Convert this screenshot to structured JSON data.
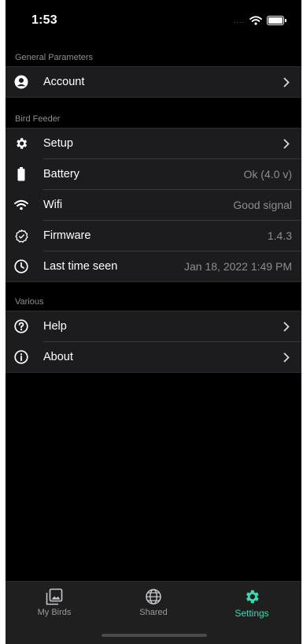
{
  "status_bar": {
    "time": "1:53",
    "signal_dots": "....",
    "wifi_icon": "wifi-icon",
    "battery_icon": "battery-icon"
  },
  "sections": {
    "general": {
      "header": "General Parameters",
      "items": [
        {
          "label": "Account",
          "icon": "user-circle-icon",
          "value": "",
          "chevron": true
        }
      ]
    },
    "bird_feeder": {
      "header": "Bird Feeder",
      "items": [
        {
          "label": "Setup",
          "icon": "gear-icon",
          "value": "",
          "chevron": true
        },
        {
          "label": "Battery",
          "icon": "battery-icon",
          "value": "Ok (4.0 v)",
          "chevron": false
        },
        {
          "label": "Wifi",
          "icon": "wifi-icon",
          "value": "Good signal",
          "chevron": false
        },
        {
          "label": "Firmware",
          "icon": "badge-check-icon",
          "value": "1.4.3",
          "chevron": false
        },
        {
          "label": "Last time seen",
          "icon": "clock-icon",
          "value": "Jan 18, 2022 1:49 PM",
          "chevron": false
        }
      ]
    },
    "various": {
      "header": "Various",
      "items": [
        {
          "label": "Help",
          "icon": "help-circle-icon",
          "value": "",
          "chevron": true
        },
        {
          "label": "About",
          "icon": "info-circle-icon",
          "value": "",
          "chevron": true
        }
      ]
    }
  },
  "tab_bar": {
    "tabs": [
      {
        "label": "My Birds",
        "icon": "photo-library-icon",
        "active": false
      },
      {
        "label": "Shared",
        "icon": "globe-icon",
        "active": false
      },
      {
        "label": "Settings",
        "icon": "gear-icon",
        "active": true
      }
    ]
  },
  "colors": {
    "background": "#000000",
    "group_background": "#1c1c1e",
    "accent": "#3fd6b4",
    "secondary_text": "#8d8d92"
  }
}
